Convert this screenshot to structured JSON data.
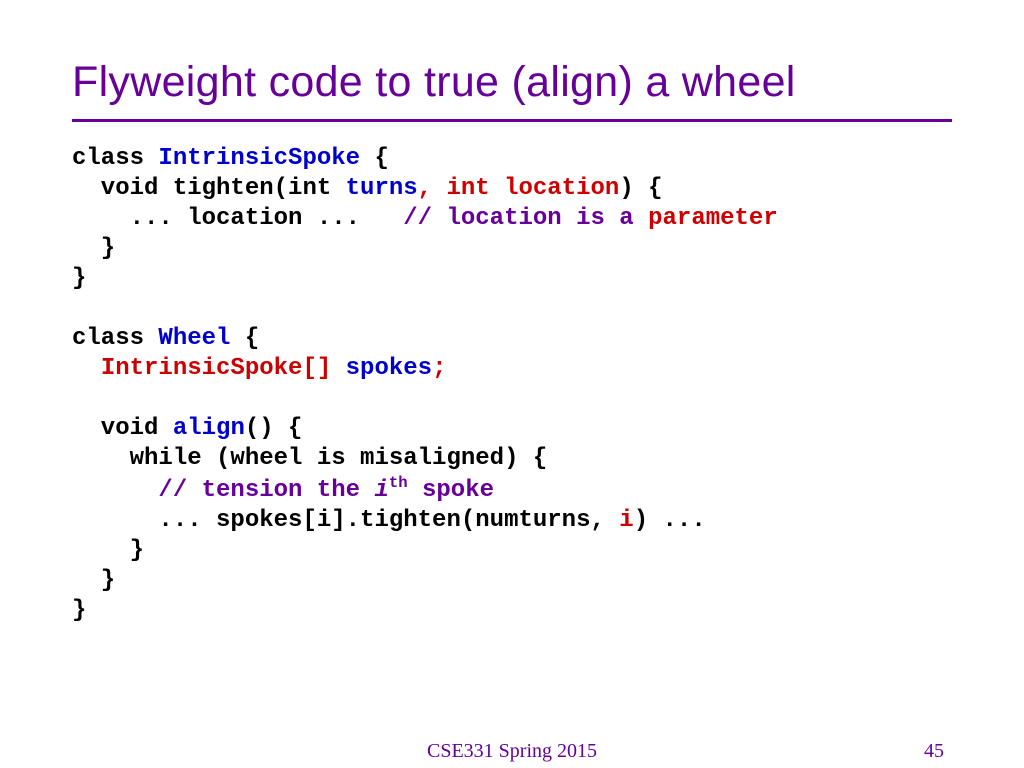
{
  "title": "Flyweight code to true (align) a wheel",
  "c": {
    "l1a": "class ",
    "l1b": "IntrinsicSpoke ",
    "l1c": "{",
    "l2a": "  void tighten(int ",
    "l2b": "turns",
    "l2c": ", ",
    "l2d": "int location",
    "l2e": ") {",
    "l3a": "    ... location ...   ",
    "l3b": "// location is a ",
    "l3c": "parameter",
    "l4": "  }",
    "l5": "}",
    "blank": "",
    "l7a": "class ",
    "l7b": "Wheel ",
    "l7c": "{",
    "l8a": "  ",
    "l8b": "IntrinsicSpoke[] ",
    "l8c": "spokes",
    "l8d": ";",
    "l10a": "  void ",
    "l10b": "align",
    "l10c": "() {",
    "l11": "    while (wheel is misaligned) {",
    "l12a": "      ",
    "l12b": "// tension the ",
    "l12c": "i",
    "l12d": "th",
    "l12e": " spoke",
    "l13a": "      ... spokes[i].tighten(numturns, ",
    "l13b": "i",
    "l13c": ") ...",
    "l14": "    }",
    "l15": "  }",
    "l16": "}"
  },
  "footer": {
    "course": "CSE331 Spring 2015",
    "page": "45"
  }
}
